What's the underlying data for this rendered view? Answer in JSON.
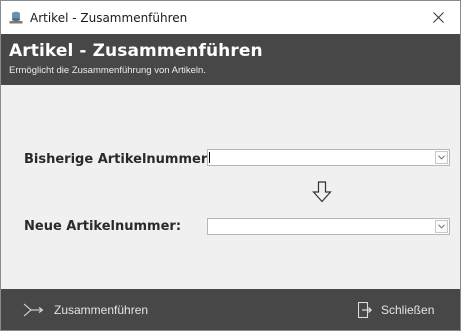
{
  "window": {
    "title": "Artikel - Zusammenführen",
    "close_glyph": "✕"
  },
  "header": {
    "title": "Artikel - Zusammenführen",
    "subtitle": "Ermöglicht die Zusammenführung von Artikeln."
  },
  "form": {
    "old_label": "Bisherige Artikelnummer:",
    "old_value": "",
    "new_label": "Neue Artikelnummer:",
    "new_value": ""
  },
  "footer": {
    "merge_label": "Zusammenführen",
    "close_label": "Schließen"
  },
  "icons": {
    "app": "database-icon",
    "arrow": "arrow-down-icon",
    "merge": "merge-arrow-icon",
    "exit": "exit-door-icon"
  },
  "colors": {
    "header_bg": "#474747",
    "body_bg": "#f0f0f0",
    "footer_bg": "#474747"
  }
}
